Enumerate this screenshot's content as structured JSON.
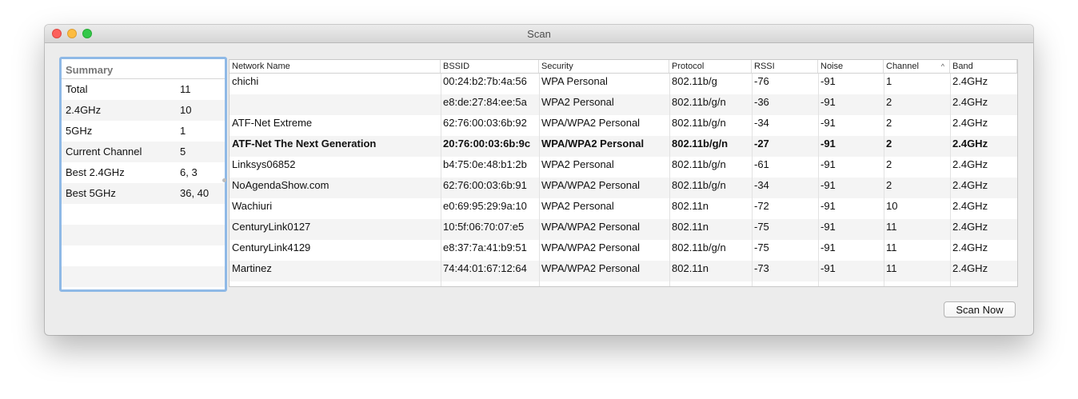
{
  "window": {
    "title": "Scan"
  },
  "summary": {
    "header": "Summary",
    "rows": [
      {
        "label": "Total",
        "value": "11"
      },
      {
        "label": "2.4GHz",
        "value": "10"
      },
      {
        "label": "5GHz",
        "value": "1"
      },
      {
        "label": "Current Channel",
        "value": "5"
      },
      {
        "label": "Best 2.4GHz",
        "value": "6, 3"
      },
      {
        "label": "Best 5GHz",
        "value": "36, 40"
      }
    ]
  },
  "table": {
    "columns": [
      "Network Name",
      "BSSID",
      "Security",
      "Protocol",
      "RSSI",
      "Noise",
      "Channel",
      "Band"
    ],
    "sort_column": "Channel",
    "sort_indicator": "^",
    "rows": [
      [
        "chichi",
        "00:24:b2:7b:4a:56",
        "WPA Personal",
        "802.11b/g",
        "-76",
        "-91",
        "1",
        "2.4GHz"
      ],
      [
        "",
        "e8:de:27:84:ee:5a",
        "WPA2 Personal",
        "802.11b/g/n",
        "-36",
        "-91",
        "2",
        "2.4GHz"
      ],
      [
        "ATF-Net Extreme",
        "62:76:00:03:6b:92",
        "WPA/WPA2 Personal",
        "802.11b/g/n",
        "-34",
        "-91",
        "2",
        "2.4GHz"
      ],
      [
        "ATF-Net The Next Generation",
        "20:76:00:03:6b:9c",
        "WPA/WPA2 Personal",
        "802.11b/g/n",
        "-27",
        "-91",
        "2",
        "2.4GHz"
      ],
      [
        "Linksys06852",
        "b4:75:0e:48:b1:2b",
        "WPA2 Personal",
        "802.11b/g/n",
        "-61",
        "-91",
        "2",
        "2.4GHz"
      ],
      [
        "NoAgendaShow.com",
        "62:76:00:03:6b:91",
        "WPA/WPA2 Personal",
        "802.11b/g/n",
        "-34",
        "-91",
        "2",
        "2.4GHz"
      ],
      [
        "Wachiuri",
        "e0:69:95:29:9a:10",
        "WPA2 Personal",
        "802.11n",
        "-72",
        "-91",
        "10",
        "2.4GHz"
      ],
      [
        "CenturyLink0127",
        "10:5f:06:70:07:e5",
        "WPA/WPA2 Personal",
        "802.11n",
        "-75",
        "-91",
        "11",
        "2.4GHz"
      ],
      [
        "CenturyLink4129",
        "e8:37:7a:41:b9:51",
        "WPA/WPA2 Personal",
        "802.11b/g/n",
        "-75",
        "-91",
        "11",
        "2.4GHz"
      ],
      [
        "Martinez",
        "74:44:01:67:12:64",
        "WPA/WPA2 Personal",
        "802.11n",
        "-73",
        "-91",
        "11",
        "2.4GHz"
      ]
    ],
    "bold_row": 3
  },
  "footer": {
    "scan_button": "Scan Now"
  }
}
